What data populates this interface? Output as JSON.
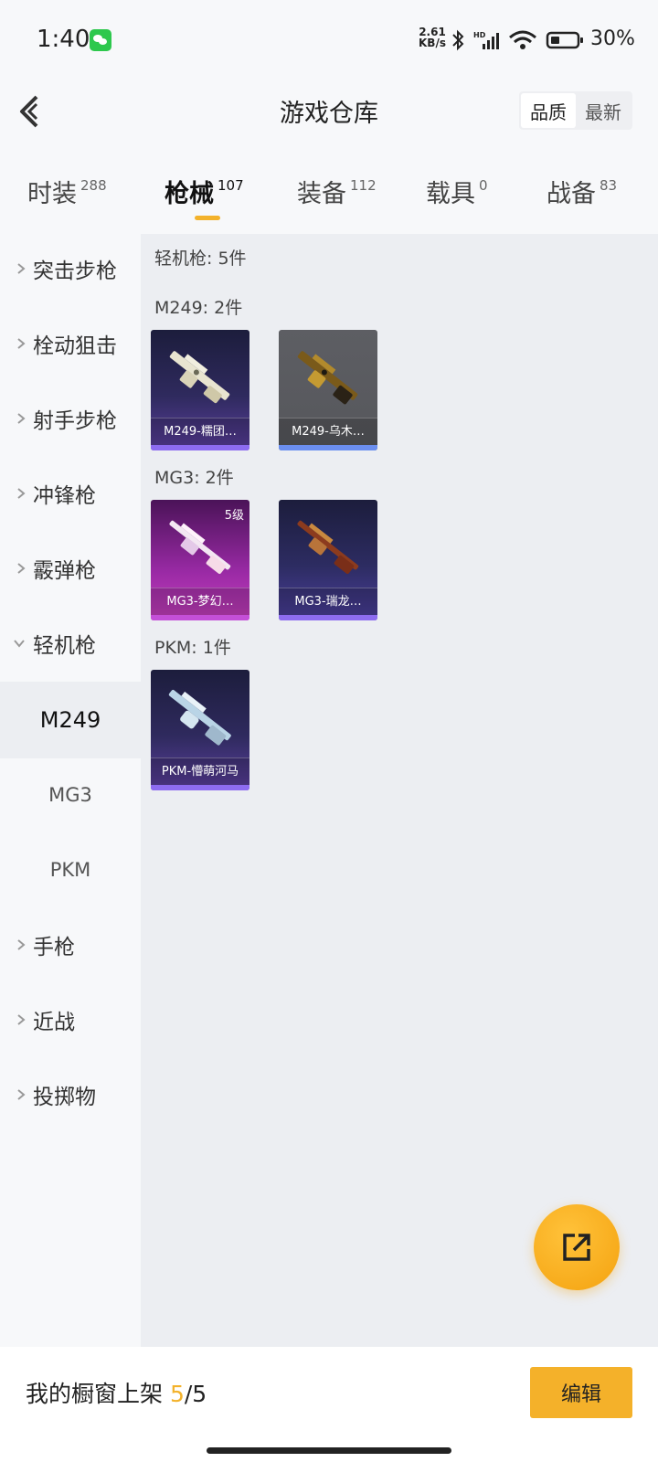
{
  "status": {
    "time": "1:40",
    "net_speed_value": "2.61",
    "net_speed_unit": "KB/s",
    "battery": "30%"
  },
  "header": {
    "title": "游戏仓库",
    "sort_options": [
      "品质",
      "最新"
    ],
    "active_sort": "品质"
  },
  "tabs": [
    {
      "label": "时装",
      "count": "288"
    },
    {
      "label": "枪械",
      "count": "107"
    },
    {
      "label": "装备",
      "count": "112"
    },
    {
      "label": "载具",
      "count": "0"
    },
    {
      "label": "战备",
      "count": "83"
    }
  ],
  "active_tab": "枪械",
  "sidebar": {
    "categories": [
      {
        "label": "突击步枪",
        "expanded": false
      },
      {
        "label": "栓动狙击",
        "expanded": false
      },
      {
        "label": "射手步枪",
        "expanded": false
      },
      {
        "label": "冲锋枪",
        "expanded": false
      },
      {
        "label": "霰弹枪",
        "expanded": false
      },
      {
        "label": "轻机枪",
        "expanded": true
      },
      {
        "label": "手枪",
        "expanded": false
      },
      {
        "label": "近战",
        "expanded": false
      },
      {
        "label": "投掷物",
        "expanded": false
      }
    ],
    "subitems": [
      "M249",
      "MG3",
      "PKM"
    ],
    "active_subitem": "M249"
  },
  "content": {
    "summary": "轻机枪: 5件",
    "groups": [
      {
        "title": "M249: 2件",
        "items": [
          {
            "name": "M249-糯团…",
            "level": "",
            "rarity": "purple"
          },
          {
            "name": "M249-乌木…",
            "level": "",
            "rarity": "gray"
          }
        ]
      },
      {
        "title": "MG3: 2件",
        "items": [
          {
            "name": "MG3-梦幻…",
            "level": "5级",
            "rarity": "pink"
          },
          {
            "name": "MG3-瑞龙…",
            "level": "",
            "rarity": "purple"
          }
        ]
      },
      {
        "title": "PKM: 1件",
        "items": [
          {
            "name": "PKM-懵萌河马",
            "level": "",
            "rarity": "purple"
          }
        ]
      }
    ]
  },
  "share_button": {
    "icon": "share-icon"
  },
  "bottom": {
    "label": "我的橱窗上架",
    "current": "5",
    "total": "/5",
    "edit_label": "编辑"
  },
  "colors": {
    "accent": "#f3b22b",
    "content_bg": "#eceef2"
  }
}
